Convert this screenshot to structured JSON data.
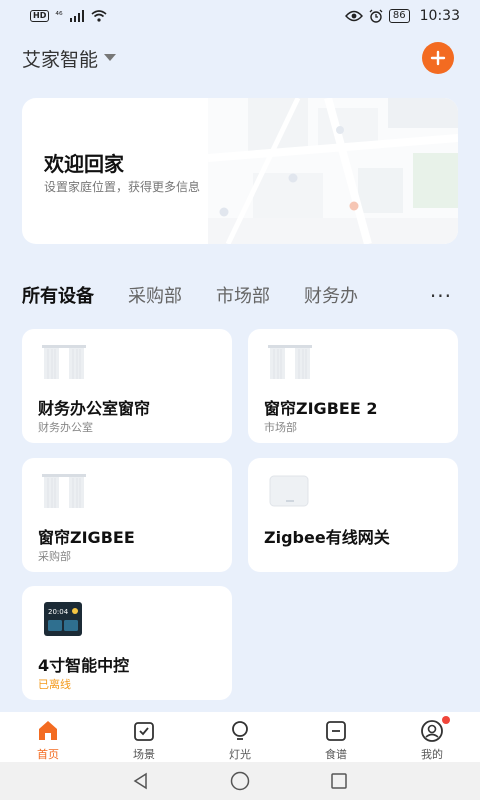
{
  "status_bar": {
    "hd": "HD",
    "network": "⁴⁶",
    "battery": "86",
    "time": "10:33"
  },
  "header": {
    "home_name": "艾家智能",
    "add_icon": "plus-icon"
  },
  "welcome": {
    "title": "欢迎回家",
    "subtitle": "设置家庭位置，获得更多信息"
  },
  "tabs": [
    {
      "label": "所有设备",
      "active": true
    },
    {
      "label": "采购部"
    },
    {
      "label": "市场部"
    },
    {
      "label": "财务办"
    }
  ],
  "more_label": "···",
  "devices": [
    {
      "name": "财务办公室窗帘",
      "room": "财务办公室",
      "icon": "curtain-icon"
    },
    {
      "name": "窗帘ZIGBEE 2",
      "room": "市场部",
      "icon": "curtain-icon"
    },
    {
      "name": "窗帘ZIGBEE",
      "room": "采购部",
      "icon": "curtain-icon"
    },
    {
      "name": "Zigbee有线网关",
      "room": "",
      "icon": "gateway-icon"
    },
    {
      "name": "4寸智能中控",
      "room": "已离线",
      "icon": "control-panel-icon",
      "offline": true,
      "panel_time": "20:04"
    }
  ],
  "bottom_nav": [
    {
      "label": "首页",
      "icon": "home-icon",
      "active": true
    },
    {
      "label": "场景",
      "icon": "scene-icon"
    },
    {
      "label": "灯光",
      "icon": "bulb-icon"
    },
    {
      "label": "食谱",
      "icon": "recipe-icon"
    },
    {
      "label": "我的",
      "icon": "profile-icon",
      "badge": true
    }
  ],
  "colors": {
    "accent": "#f36b21",
    "background": "#e9f0fb",
    "offline": "#f39a1c",
    "badge": "#f0453a"
  }
}
